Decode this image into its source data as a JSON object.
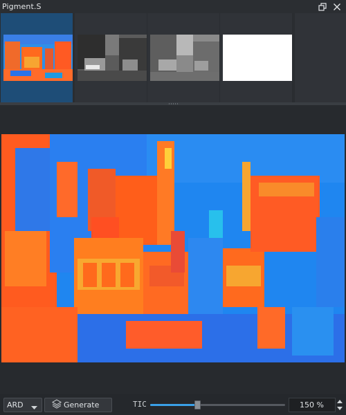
{
  "window": {
    "title": "Pigment.S",
    "icons": [
      "restore-icon",
      "close-icon"
    ]
  },
  "thumbnails": [
    {
      "name": "thumb-false-color",
      "selected": true
    },
    {
      "name": "thumb-grayscale-dark",
      "selected": false
    },
    {
      "name": "thumb-grayscale",
      "selected": false
    },
    {
      "name": "thumb-white",
      "selected": false
    },
    {
      "name": "thumb-empty",
      "selected": false
    }
  ],
  "bottombar": {
    "mode_select": "ARD",
    "generate_label": "Generate",
    "slider_label": "TIC",
    "slider_value": 0.35,
    "zoom_value": "150 %"
  },
  "colors": {
    "accent": "#3aa0e8",
    "selected": "#1e4d77"
  }
}
